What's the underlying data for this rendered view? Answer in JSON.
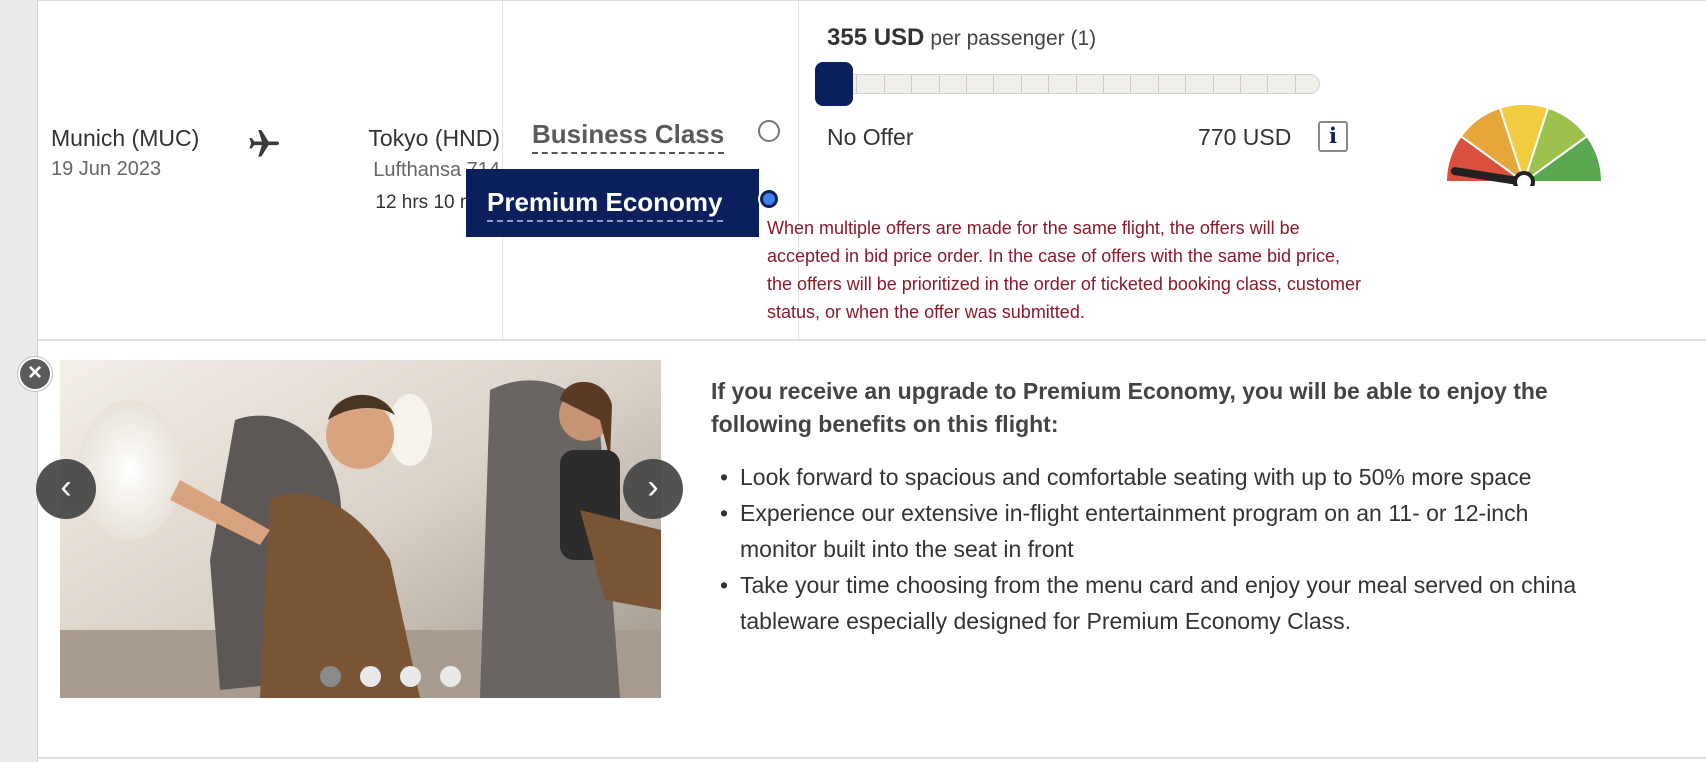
{
  "flight": {
    "origin_city": "Munich (MUC)",
    "date": "19 Jun 2023",
    "destination_city": "Tokyo (HND)",
    "flight_number": "Lufthansa 714",
    "duration": "12 hrs 10 mins"
  },
  "cabin_options": {
    "business": "Business Class",
    "premium": "Premium Economy",
    "selected": "premium"
  },
  "offer": {
    "price": "355 USD",
    "price_suffix": "per passenger (1)",
    "slider_value_fraction": 0.0,
    "min_label": "No Offer",
    "max_label": "770 USD",
    "info_label": "i",
    "disclaimer": "When multiple offers are made for the same flight, the offers will be accepted in bid price order. In the case of offers with the same bid price, the offers will be prioritized in the order of ticketed booking class, customer status, or when the offer was submitted."
  },
  "gauge": {
    "colors": [
      "#d9503c",
      "#e7a63a",
      "#f2cc41",
      "#9dc14d",
      "#5aa84f"
    ],
    "needle_level": 0.05
  },
  "carousel": {
    "prev_label": "‹",
    "next_label": "›",
    "close_label": "×",
    "slide_count": 4,
    "active_slide": 0
  },
  "benefits": {
    "heading": "If you receive an upgrade to Premium Economy, you will be able to enjoy the following benefits on this flight:",
    "items": [
      "Look forward to spacious and comfortable seating with up to 50% more space",
      "Experience our extensive in-flight entertainment program on an 11- or 12-inch monitor built into the seat in front",
      "Take your time choosing from the menu card and enjoy your meal served on china tableware especially designed for Premium Economy Class."
    ]
  },
  "colors": {
    "navy": "#0a1f5c",
    "disclaimer": "#8b1a2b",
    "radio_selected": "#3f7fe6"
  }
}
